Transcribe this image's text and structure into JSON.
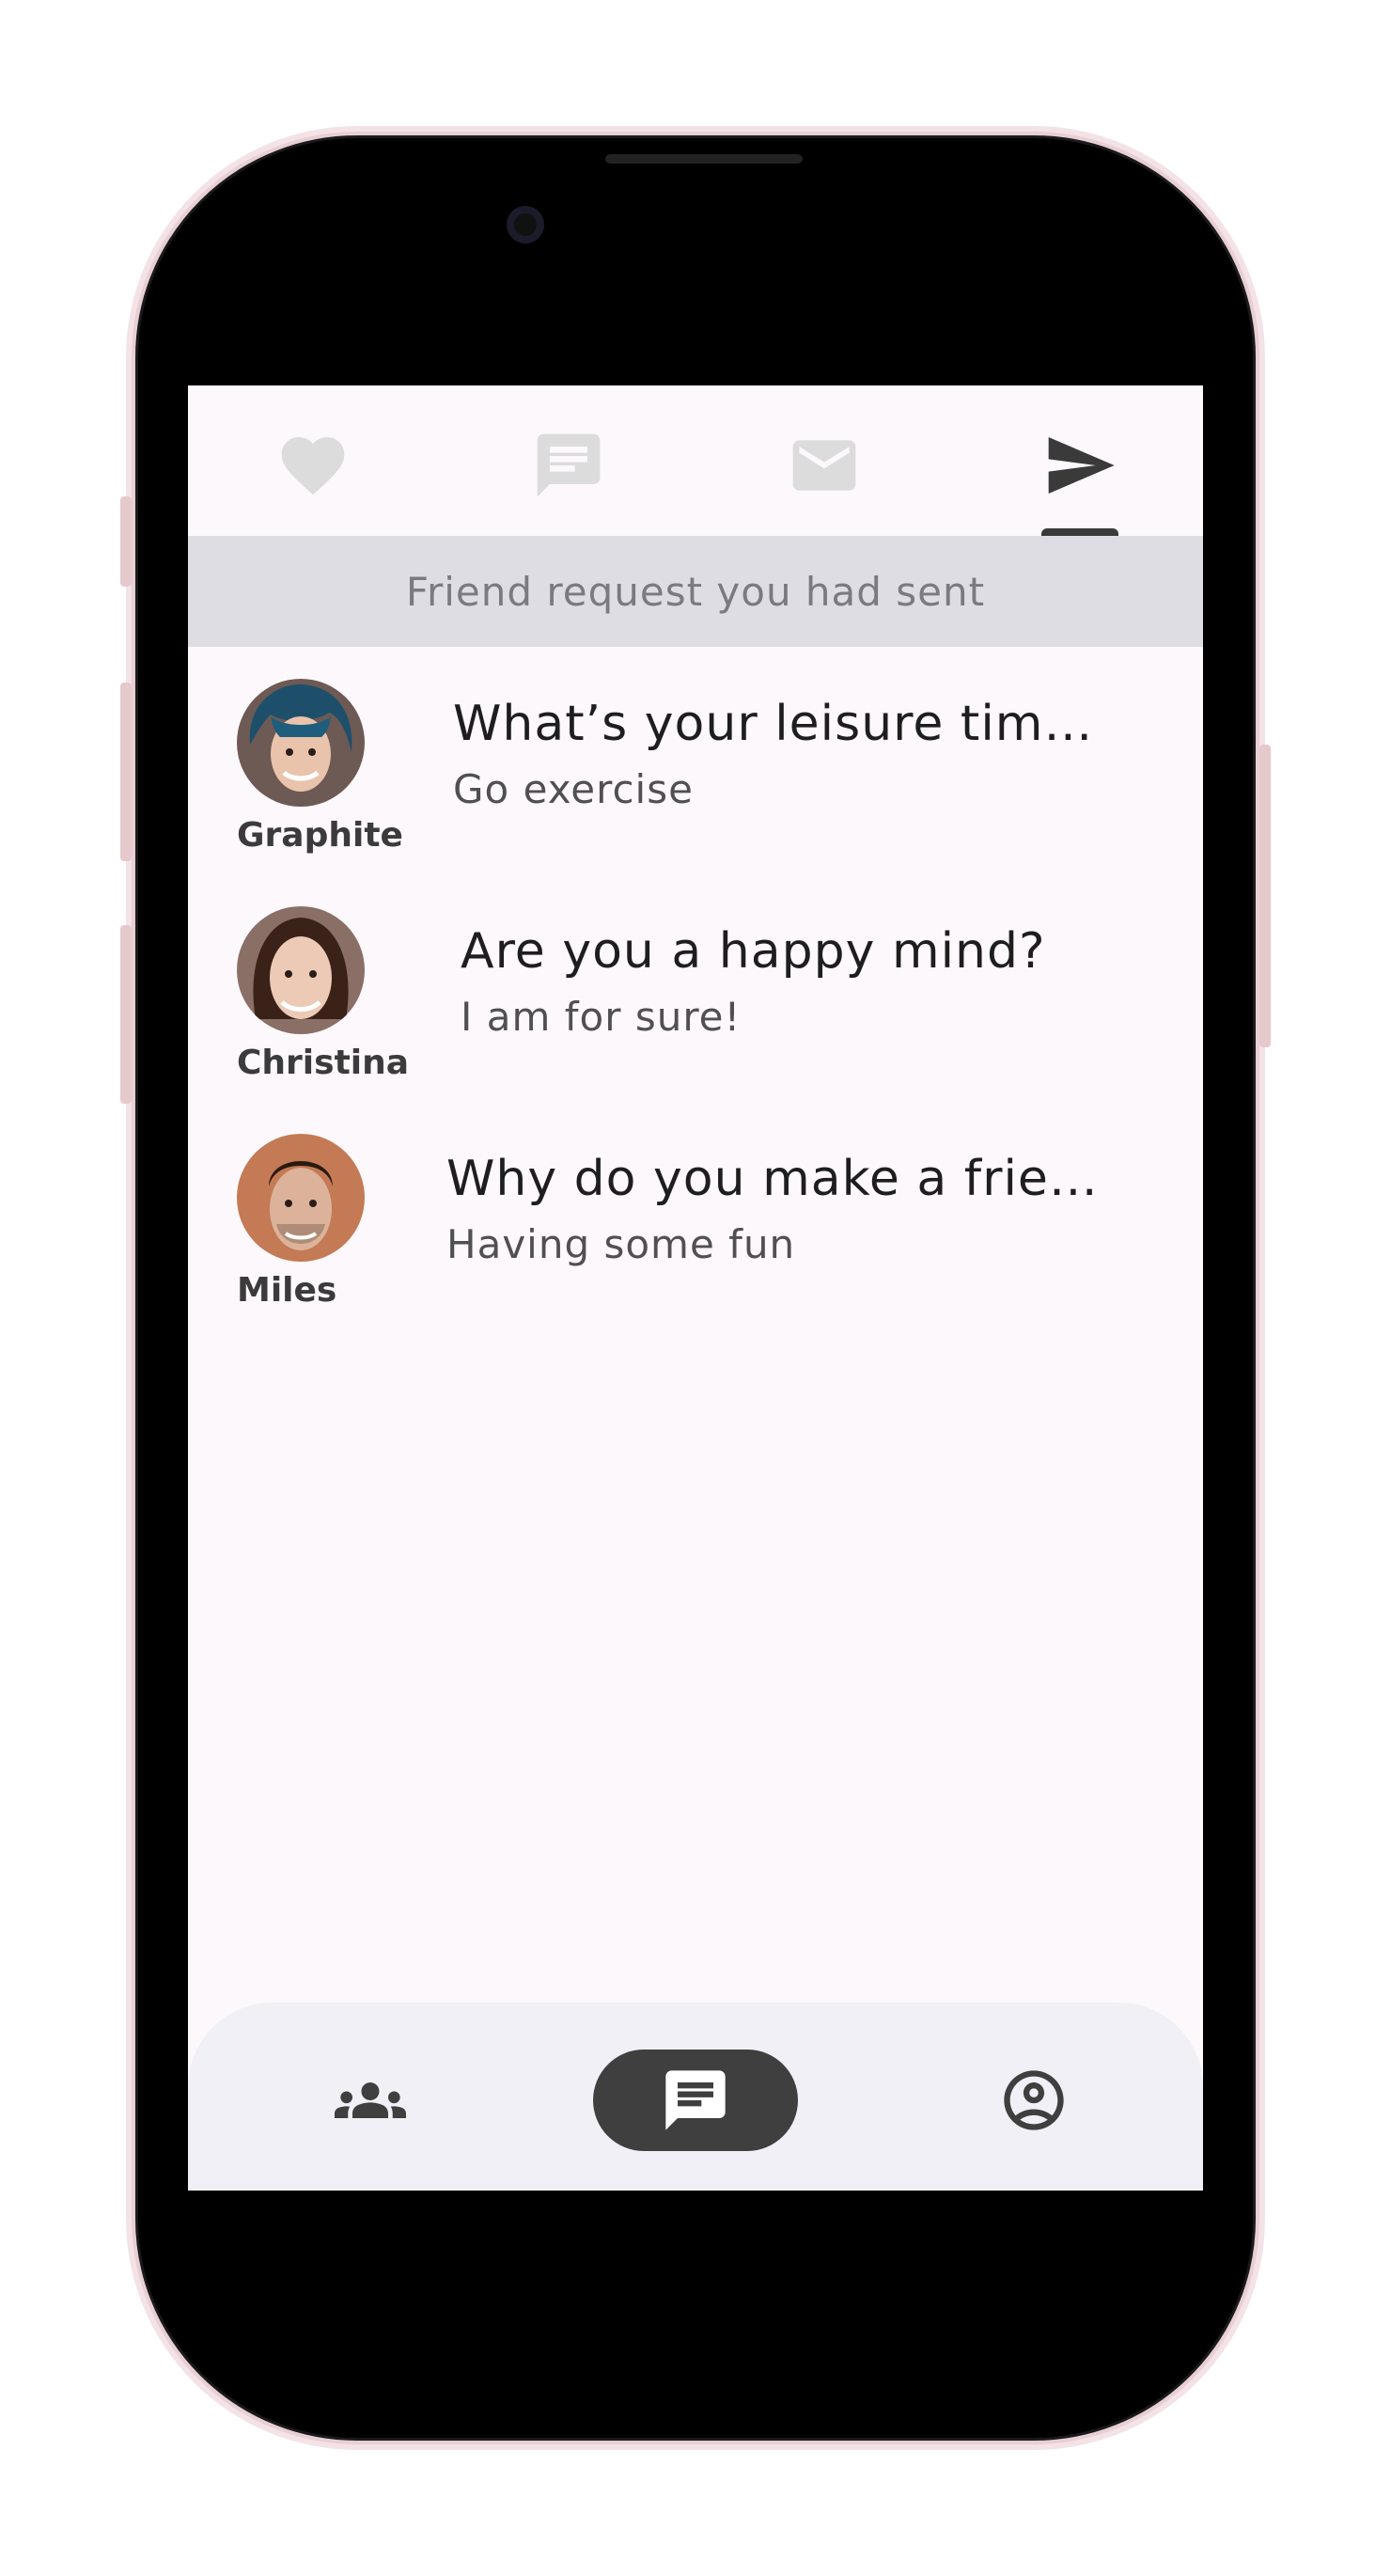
{
  "top_tabs": [
    {
      "icon": "heart-icon",
      "active": false
    },
    {
      "icon": "chat-icon",
      "active": false
    },
    {
      "icon": "mail-icon",
      "active": false
    },
    {
      "icon": "send-icon",
      "active": true
    }
  ],
  "banner": {
    "text": "Friend request you had sent"
  },
  "requests": [
    {
      "name": "Graphite",
      "title": "What’s your leisure tim…",
      "subtitle": "Go exercise"
    },
    {
      "name": "Christina",
      "title": "Are you a happy mind?",
      "subtitle": "I am for sure!"
    },
    {
      "name": "Miles",
      "title": "Why do you make a frie…",
      "subtitle": "Having some fun"
    }
  ],
  "bottom_nav": [
    {
      "icon": "people-icon",
      "active": false
    },
    {
      "icon": "chat-icon",
      "active": true
    },
    {
      "icon": "account-circle-icon",
      "active": false
    }
  ],
  "colors": {
    "accent": "#3f3f3f",
    "banner_bg": "#dedde4",
    "screen_bg": "#fdf8fc",
    "inactive_icon": "#dcdcdc"
  }
}
